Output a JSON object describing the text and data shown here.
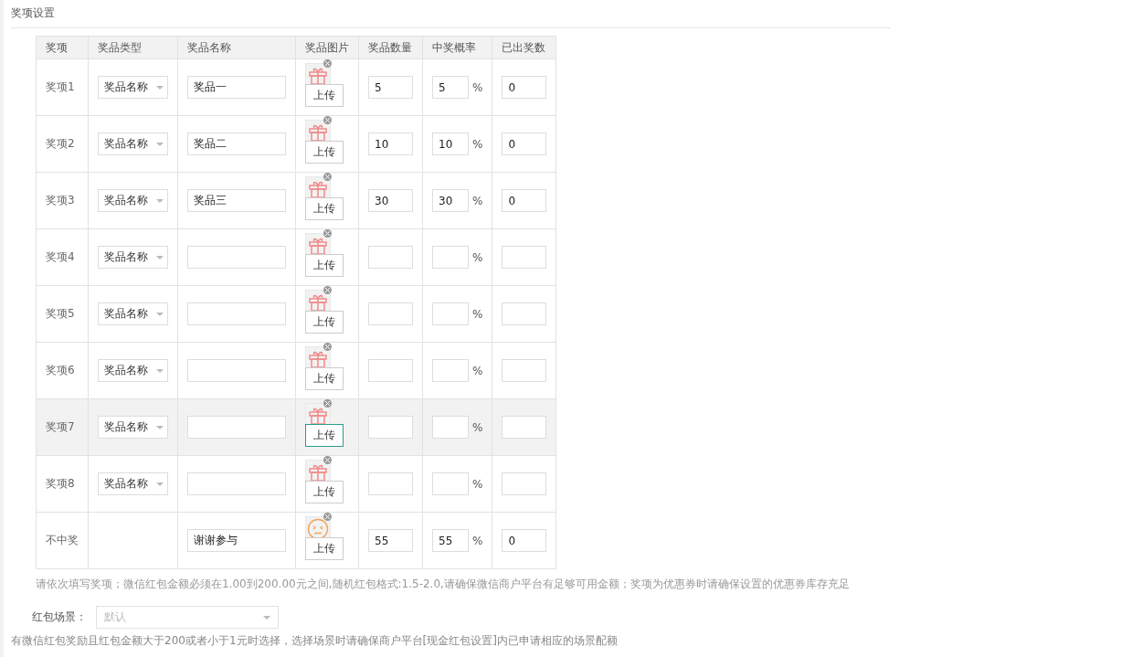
{
  "section_title": "奖项设置",
  "table": {
    "columns": [
      "奖项",
      "奖品类型",
      "奖品名称",
      "奖品图片",
      "奖品数量",
      "中奖概率",
      "已出奖数"
    ],
    "rows": [
      {
        "label": "奖项1",
        "type": "奖品名称",
        "name": "奖品一",
        "kind": "prize",
        "upload": "上传",
        "quantity": "5",
        "probability": "5",
        "percent": "%",
        "issued": "0",
        "highlighted": false,
        "upload_focused": false
      },
      {
        "label": "奖项2",
        "type": "奖品名称",
        "name": "奖品二",
        "kind": "prize",
        "upload": "上传",
        "quantity": "10",
        "probability": "10",
        "percent": "%",
        "issued": "0",
        "highlighted": false,
        "upload_focused": false
      },
      {
        "label": "奖项3",
        "type": "奖品名称",
        "name": "奖品三",
        "kind": "prize",
        "upload": "上传",
        "quantity": "30",
        "probability": "30",
        "percent": "%",
        "issued": "0",
        "highlighted": false,
        "upload_focused": false
      },
      {
        "label": "奖项4",
        "type": "奖品名称",
        "kind": "prize",
        "upload": "上传",
        "percent": "%",
        "highlighted": false,
        "upload_focused": false
      },
      {
        "label": "奖项5",
        "type": "奖品名称",
        "kind": "prize",
        "upload": "上传",
        "percent": "%",
        "highlighted": false,
        "upload_focused": false
      },
      {
        "label": "奖项6",
        "type": "奖品名称",
        "kind": "prize",
        "upload": "上传",
        "percent": "%",
        "highlighted": false,
        "upload_focused": false
      },
      {
        "label": "奖项7",
        "type": "奖品名称",
        "kind": "prize",
        "upload": "上传",
        "percent": "%",
        "highlighted": true,
        "upload_focused": true
      },
      {
        "label": "奖项8",
        "type": "奖品名称",
        "kind": "prize",
        "upload": "上传",
        "percent": "%",
        "highlighted": false,
        "upload_focused": false
      },
      {
        "label": "不中奖",
        "name": "谢谢参与",
        "kind": "no_prize",
        "upload": "上传",
        "quantity": "55",
        "probability": "55",
        "percent": "%",
        "issued": "0",
        "highlighted": false,
        "upload_focused": false
      }
    ]
  },
  "table_note": "请依次填写奖项；微信红包金额必须在1.00到200.00元之间,随机红包格式:1.5-2.0,请确保微信商户平台有足够可用金额；奖项为优惠券时请确保设置的优惠券库存充足",
  "scene": {
    "label": "红包场景：",
    "placeholder": "默认"
  },
  "scene_note": "有微信红包奖励且红包金额大于200或者小于1元时选择，选择场景时请确保商户平台[现金红包设置]内已申请相应的场景配额"
}
